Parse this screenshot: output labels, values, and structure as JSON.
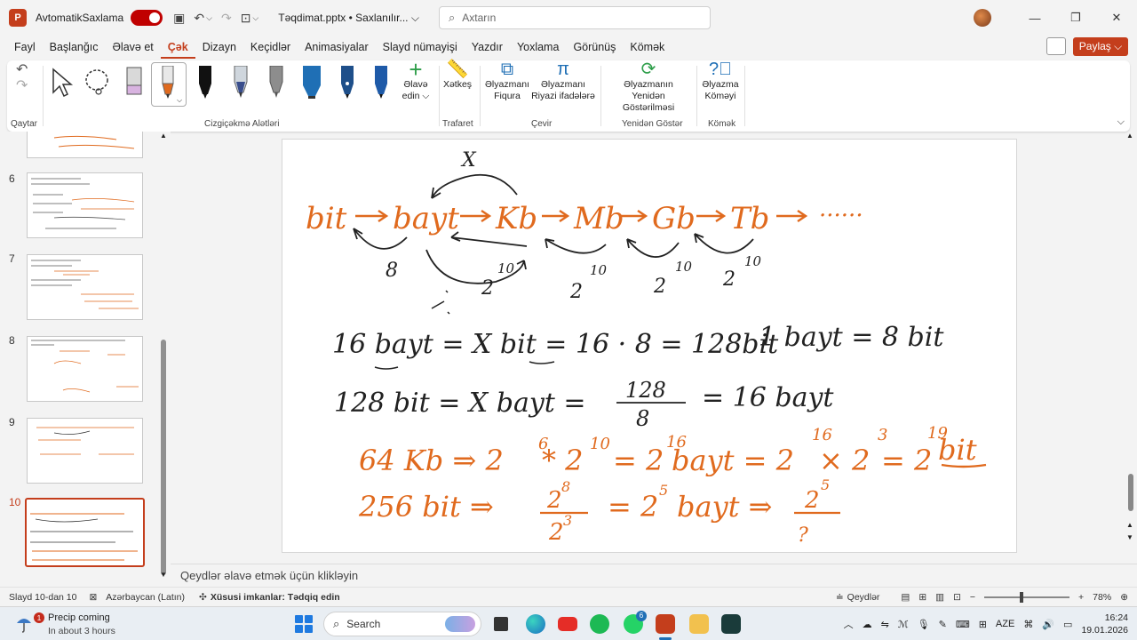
{
  "titlebar": {
    "app_logo": "P",
    "autosave_label": "AvtomatikSaxlama",
    "doc_title": "Təqdimat.pptx • Saxlanılır... ⌵",
    "search_placeholder": "Axtarın"
  },
  "tabs": [
    "Fayl",
    "Başlanğıc",
    "Əlavə et",
    "Çək",
    "Dizayn",
    "Keçidlər",
    "Animasiyalar",
    "Slayd nümayişi",
    "Yazdır",
    "Yoxlama",
    "Görünüş",
    "Kömək"
  ],
  "active_tab": "Çək",
  "share_label": "Paylaş ⌵",
  "ribbon": {
    "group_undo": "Qaytar",
    "group_tools": "Cizgiçəkmə Alətləri",
    "add_pen_label": "Əlavə edin ⌵",
    "ruler_label": "Xətkeş",
    "group_stencils": "Trafaret",
    "ink_to_shape": "Əlyazmanı Fiqura",
    "ink_to_math": "Əlyazmanı Riyazi ifadələrə",
    "group_convert": "Çevir",
    "ink_replay": "Əlyazmanın Yenidən Göstərilməsi",
    "group_replay": "Yenidən Göstər",
    "ink_help": "Əlyazma Köməyi",
    "group_help": "Kömək"
  },
  "colors": {
    "accent": "#c43e1c",
    "ink_orange": "#e06a1e",
    "ink_dark": "#222222"
  },
  "thumbnails": [
    {
      "num": "6"
    },
    {
      "num": "7"
    },
    {
      "num": "8"
    },
    {
      "num": "9"
    },
    {
      "num": "10",
      "active": true
    }
  ],
  "slide": {
    "line1": {
      "items": [
        "bit",
        "bayt",
        "Kb",
        "Mb",
        "Gb",
        "Tb",
        "......"
      ],
      "factors": [
        "8",
        "2",
        "10",
        "2",
        "10",
        "2",
        "10",
        "2",
        "10"
      ],
      "x_mark": "X"
    },
    "line2_left": "16 bayt = X bit = 16 · 8 = 128bit",
    "line2_right": "1 bayt = 8 bit",
    "line3_left": "128 bit = X bayt =",
    "line3_frac_num": "128",
    "line3_frac_den": "8",
    "line3_right": "= 16 bayt",
    "line4_a": "64 Kb ⇒ 2",
    "line4_b": "* 2",
    "line4_c": "= 2",
    "line4_d": "bayt = 2",
    "line4_e": "× 2",
    "line4_f": "= 2",
    "line4_g": "bit",
    "line4_sup": [
      "6",
      "10",
      "16",
      "16",
      "3",
      "19"
    ],
    "line5_a": "256 bit ⇒",
    "line5_frac_num": "2",
    "line5_frac_num_sup": "8",
    "line5_frac_den": "2",
    "line5_frac_den_sup": "3",
    "line5_b": "= 2",
    "line5_b_sup": "5",
    "line5_c": "bayt ⇒",
    "line5_frac2_num": "2",
    "line5_frac2_num_sup": "5",
    "line5_frac2_den": "?"
  },
  "notes_placeholder": "Qeydlər əlavə etmək üçün klikləyin",
  "status": {
    "slide_count": "Slayd 10-dan 10",
    "language": "Azərbaycan (Latın)",
    "accessibility": "Xüsusi imkanlar: Tədqiq edin",
    "notes_button": "Qeydlər",
    "zoom": "78%"
  },
  "taskbar": {
    "weather_badge": "1",
    "weather_title": "Precip coming",
    "weather_sub": "In about 3 hours",
    "search_label": "Search",
    "whatsapp_badge": "6",
    "lang": "AZE",
    "time": "16:24",
    "date": "19.01.2026"
  }
}
